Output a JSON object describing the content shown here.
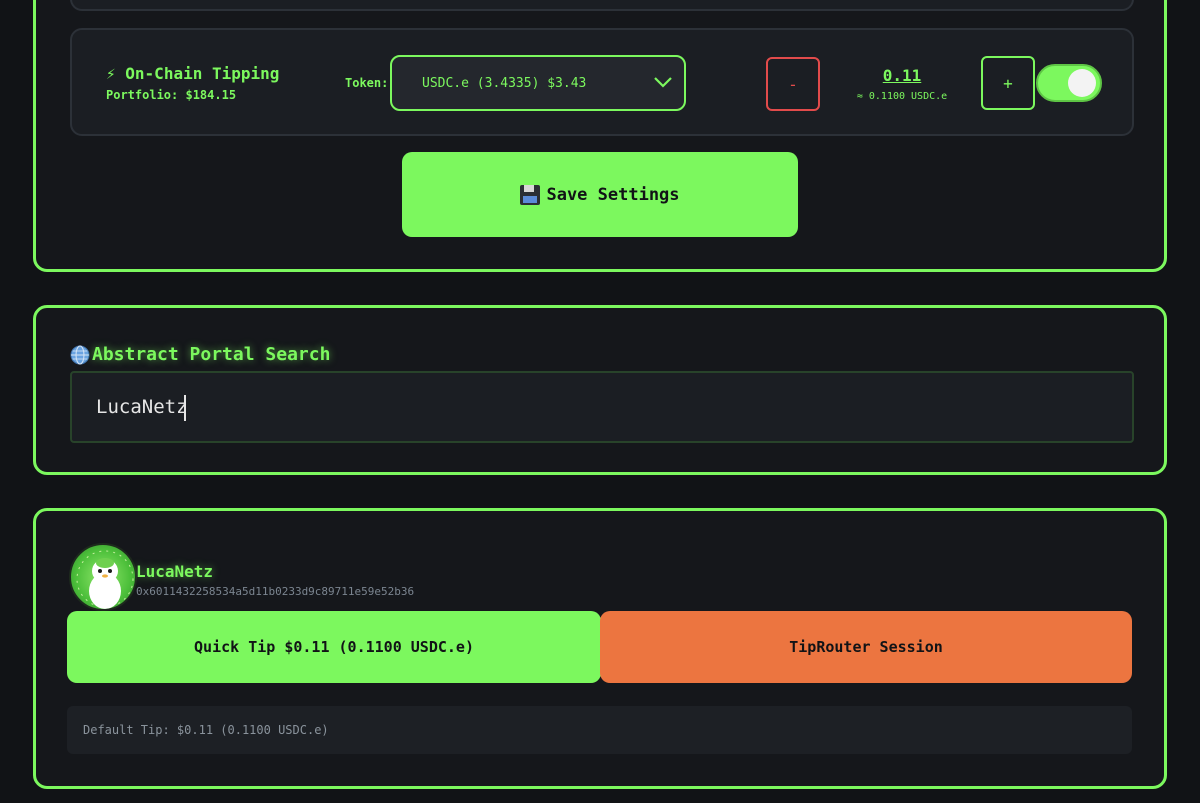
{
  "settings": {
    "tipping_title": "On-Chain Tipping",
    "portfolio": "Portfolio: $184.15",
    "token_label": "Token:",
    "token_selected": "USDC.e (3.4335) $3.43",
    "minus_label": "-",
    "plus_label": "+",
    "amount": "0.11",
    "amount_sub": "≈ 0.1100 USDC.e",
    "toggle_on": true,
    "save_label": "Save Settings"
  },
  "search": {
    "title": "Abstract Portal Search",
    "value": "LucaNetz"
  },
  "result": {
    "name": "LucaNetz",
    "address": "0x6011432258534a5d11b0233d9c89711e59e52b36",
    "quick_tip_label": "Quick Tip $0.11 (0.1100 USDC.e)",
    "router_label": "TipRouter Session",
    "default_tip": "Default Tip: $0.11 (0.1100 USDC.e)"
  },
  "colors": {
    "accent": "#7CF85E",
    "danger": "#e24b4b",
    "router": "#EC7540",
    "background": "#111316"
  }
}
